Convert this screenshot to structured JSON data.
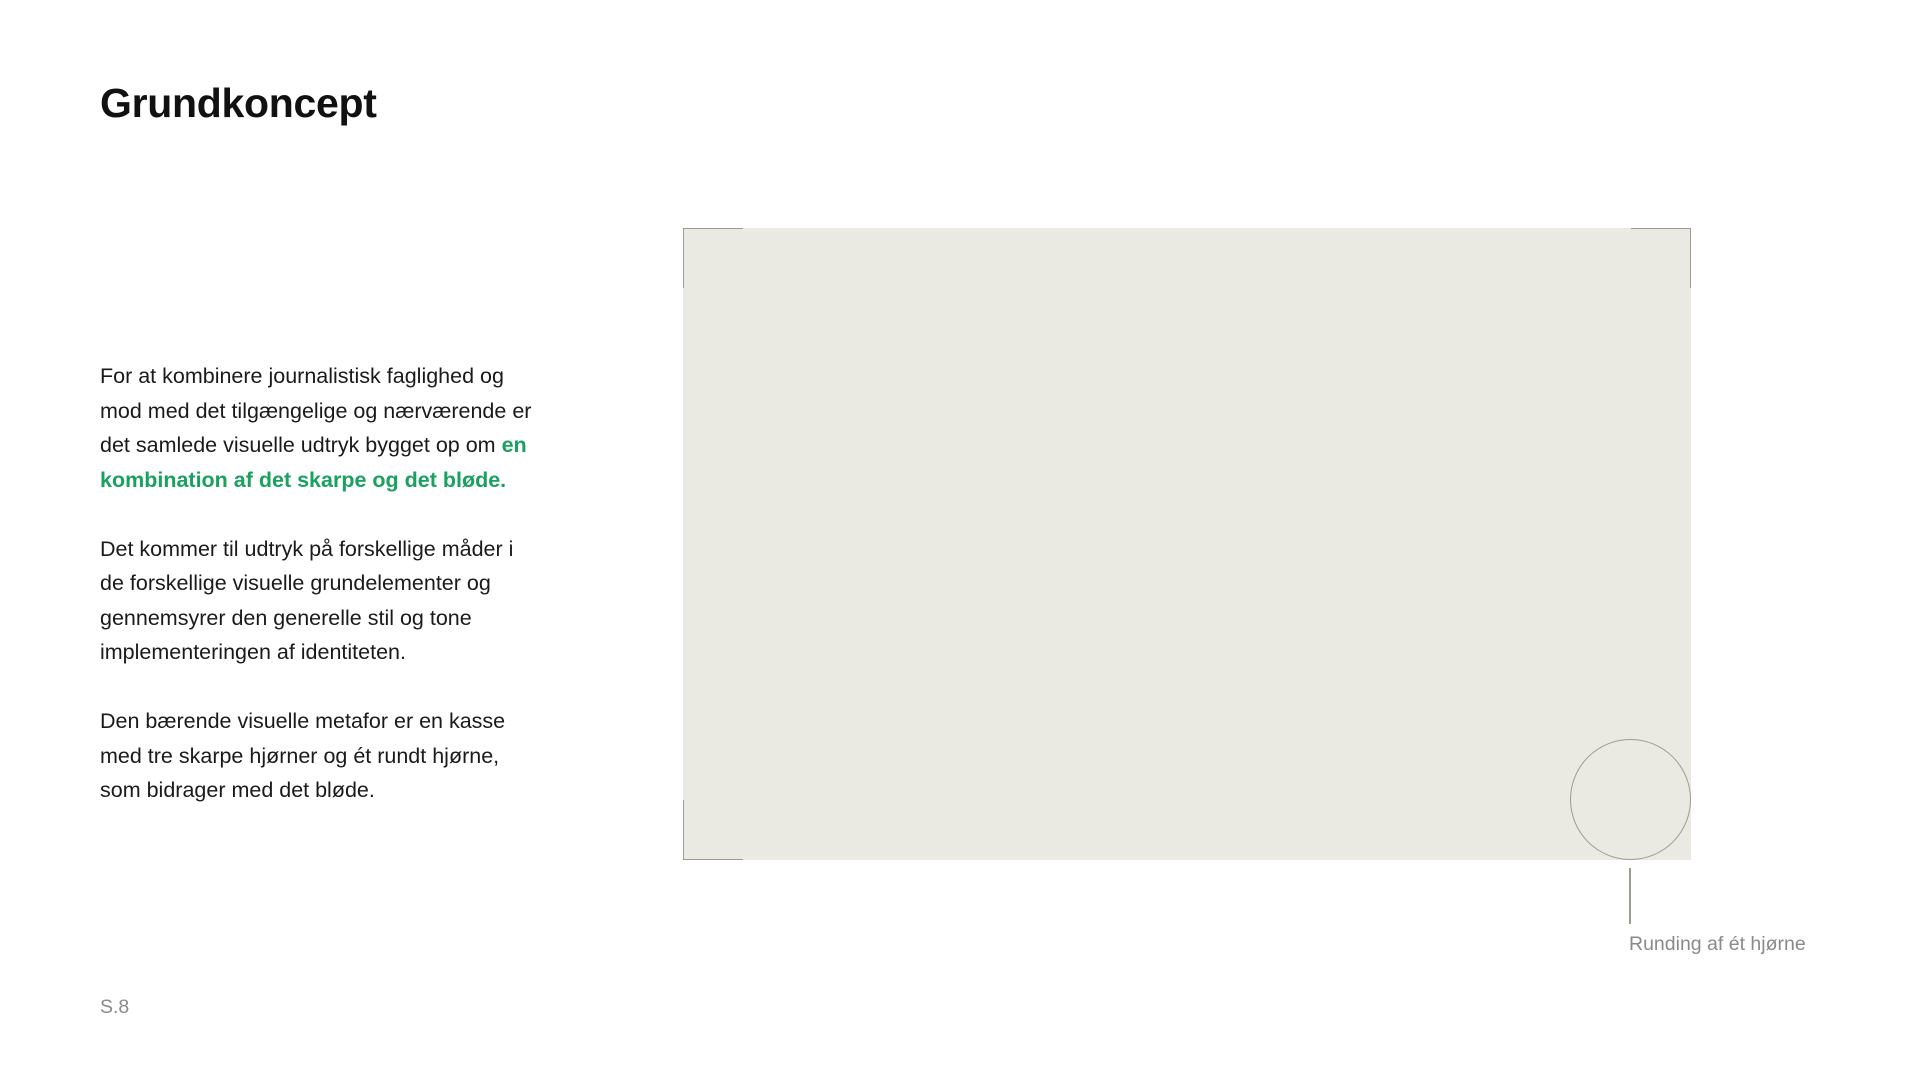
{
  "title": "Grundkoncept",
  "body": {
    "p1_before": "For at kombinere journalistisk faglighed og mod med det tilgængelige og nærværende er det samlede visuelle udtryk bygget op om ",
    "p1_highlight": "en kombination af det skarpe og det bløde.",
    "p2": "Det kommer til udtryk på forskellige måder i de forskellige visuelle grundelementer og gennemsyrer den generelle stil og tone implementeringen af identiteten.",
    "p3": "Den bærende visuelle metafor er en kasse med tre skarpe hjørner og ét rundt hjørne, som bidrager med det bløde."
  },
  "illustration": {
    "callout_label": "Runding af ét hjørne"
  },
  "page_number": "S.8",
  "colors": {
    "accent_green": "#1aa060",
    "box_fill": "#ebeae2",
    "guide_stroke": "#9c9c92",
    "muted_text": "#8a8a8a"
  }
}
